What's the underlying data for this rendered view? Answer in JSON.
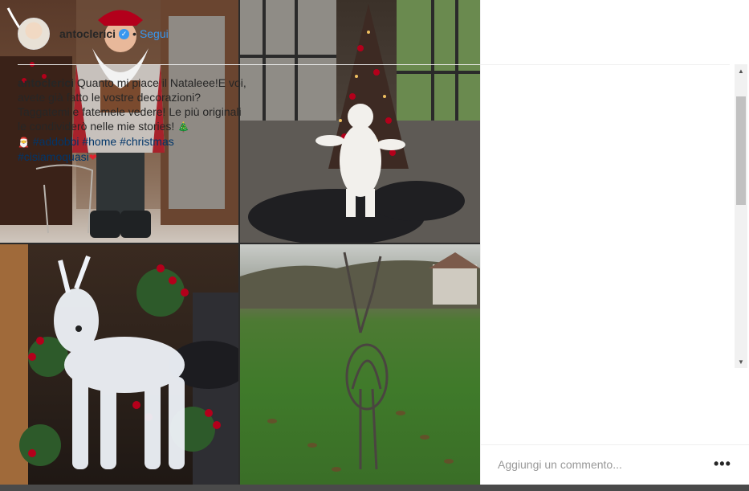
{
  "post": {
    "username": "antoclerici",
    "follow_label": "Segui",
    "separator": "•",
    "caption_user": "antoclerici",
    "caption_text": "Quanto mi piace il Natale​ee!E voi, avete già fatto le vostre decorazioni? Taggatemi e fatemele vedere! Le più originali le condividerò nelle mie stories!",
    "emoji_tree": "🎄",
    "emoji_santa": "🎅",
    "emoji_heart": "❤",
    "hashtags": [
      "#addobbi",
      "#home",
      "#christmas",
      "#cisiamoquasi"
    ]
  },
  "comment": {
    "placeholder": "Aggiungi un commento...",
    "more_label": "•••"
  },
  "scrollbar": {
    "up": "▲",
    "down": "▼"
  },
  "colors": {
    "link": "#3897f0",
    "hashtag": "#003569",
    "verified": "#3897f0"
  },
  "icons": [
    "verified-badge-icon",
    "more-options-icon"
  ]
}
